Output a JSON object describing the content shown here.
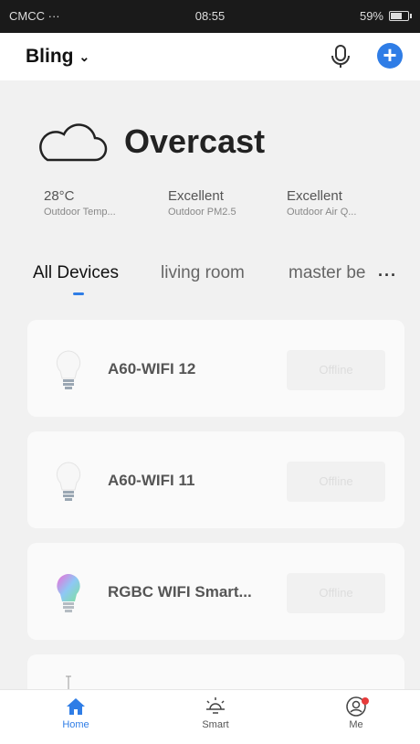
{
  "status_bar": {
    "carrier": "CMCC",
    "time": "08:55",
    "battery": "59%"
  },
  "header": {
    "home_name": "Bling",
    "add_icon": "plus-icon",
    "mic_icon": "microphone-icon"
  },
  "weather": {
    "condition": "Overcast",
    "icon": "cloud-icon",
    "stats": [
      {
        "value": "28°C",
        "label": "Outdoor Temp..."
      },
      {
        "value": "Excellent",
        "label": "Outdoor PM2.5"
      },
      {
        "value": "Excellent",
        "label": "Outdoor Air Q..."
      }
    ]
  },
  "tabs": [
    "All Devices",
    "living room",
    "master be"
  ],
  "active_tab": "All Devices",
  "devices": [
    {
      "name": "A60-WIFI 12",
      "status": "Offline",
      "icon": "bulb-icon"
    },
    {
      "name": "A60-WIFI 11",
      "status": "Offline",
      "icon": "bulb-icon"
    },
    {
      "name": "RGBC WIFI Smart...",
      "status": "Offline",
      "icon": "rgb-bulb-icon"
    }
  ],
  "bottom_nav": [
    {
      "label": "Home",
      "icon": "home-icon"
    },
    {
      "label": "Smart",
      "icon": "sun-icon"
    },
    {
      "label": "Me",
      "icon": "profile-icon"
    }
  ],
  "colors": {
    "accent": "#2f7de6",
    "badge": "#e63b3b",
    "background": "#f1f1f1"
  }
}
